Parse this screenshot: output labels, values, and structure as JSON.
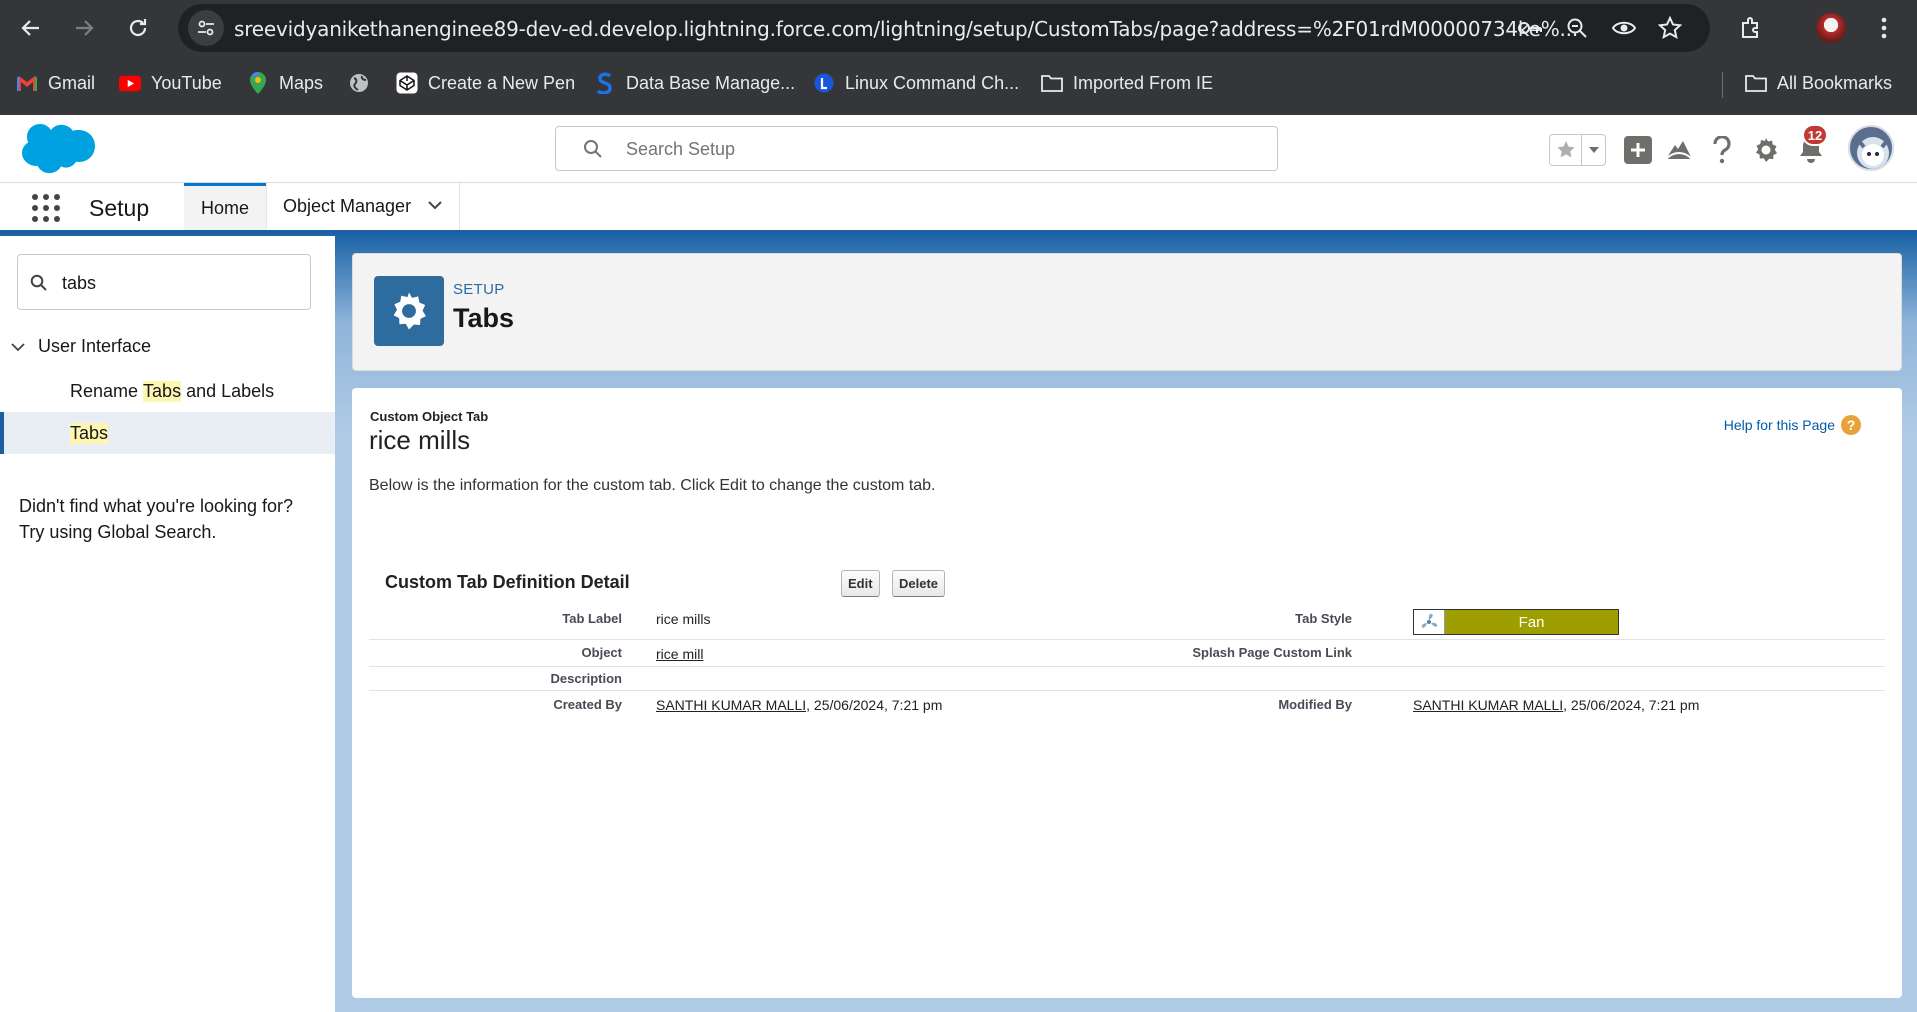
{
  "browser": {
    "url": "sreevidyanikethanenginee89-dev-ed.develop.lightning.force.com/lightning/setup/CustomTabs/page?address=%2F01rdM00000734ke%...",
    "bookmarks": [
      {
        "label": "Gmail",
        "icon": "gmail-icon"
      },
      {
        "label": "YouTube",
        "icon": "youtube-icon"
      },
      {
        "label": "Maps",
        "icon": "maps-icon"
      },
      {
        "label": "",
        "icon": "globe-icon"
      },
      {
        "label": "Create a New Pen",
        "icon": "codepen-icon"
      },
      {
        "label": "Data Base Manage...",
        "icon": "bookmark-s-icon"
      },
      {
        "label": "Linux Command Ch...",
        "icon": "bookmark-l-icon"
      },
      {
        "label": "Imported From IE",
        "icon": "folder-icon"
      }
    ],
    "all_bookmarks": "All Bookmarks"
  },
  "header": {
    "search_placeholder": "Search Setup",
    "notifications_count": "12"
  },
  "context": {
    "app_name": "Setup",
    "tabs": [
      {
        "label": "Home",
        "selected": true
      },
      {
        "label": "Object Manager",
        "selected": false
      }
    ]
  },
  "sidebar": {
    "quick_find_value": "tabs",
    "group": "User Interface",
    "items": [
      {
        "pre": "Rename ",
        "highlight": "Tabs",
        "post": " and Labels",
        "selected": false
      },
      {
        "pre": "",
        "highlight": "Tabs",
        "post": "",
        "selected": true
      }
    ],
    "not_found": "Didn't find what you're looking for? Try using Global Search."
  },
  "page_header": {
    "eyebrow": "SETUP",
    "title": "Tabs"
  },
  "detail": {
    "type": "Custom Object Tab",
    "name": "rice mills",
    "help_link": "Help for this Page",
    "description": "Below is the information for the custom tab. Click Edit to change the custom tab.",
    "section_title": "Custom Tab Definition Detail",
    "edit_label": "Edit",
    "delete_label": "Delete",
    "fields": {
      "tab_label": {
        "label": "Tab Label",
        "value": "rice mills"
      },
      "tab_style": {
        "label": "Tab Style",
        "value": "Fan",
        "color": "#9e9e00"
      },
      "object": {
        "label": "Object",
        "value": "rice mill"
      },
      "splash": {
        "label": "Splash Page Custom Link",
        "value": ""
      },
      "description": {
        "label": "Description",
        "value": ""
      },
      "created_by": {
        "label": "Created By",
        "user": "SANTHI KUMAR MALLI",
        "date": ", 25/06/2024, 7:21 pm"
      },
      "modified_by": {
        "label": "Modified By",
        "user": "SANTHI KUMAR MALLI",
        "date": ", 25/06/2024, 7:21 pm"
      }
    }
  }
}
